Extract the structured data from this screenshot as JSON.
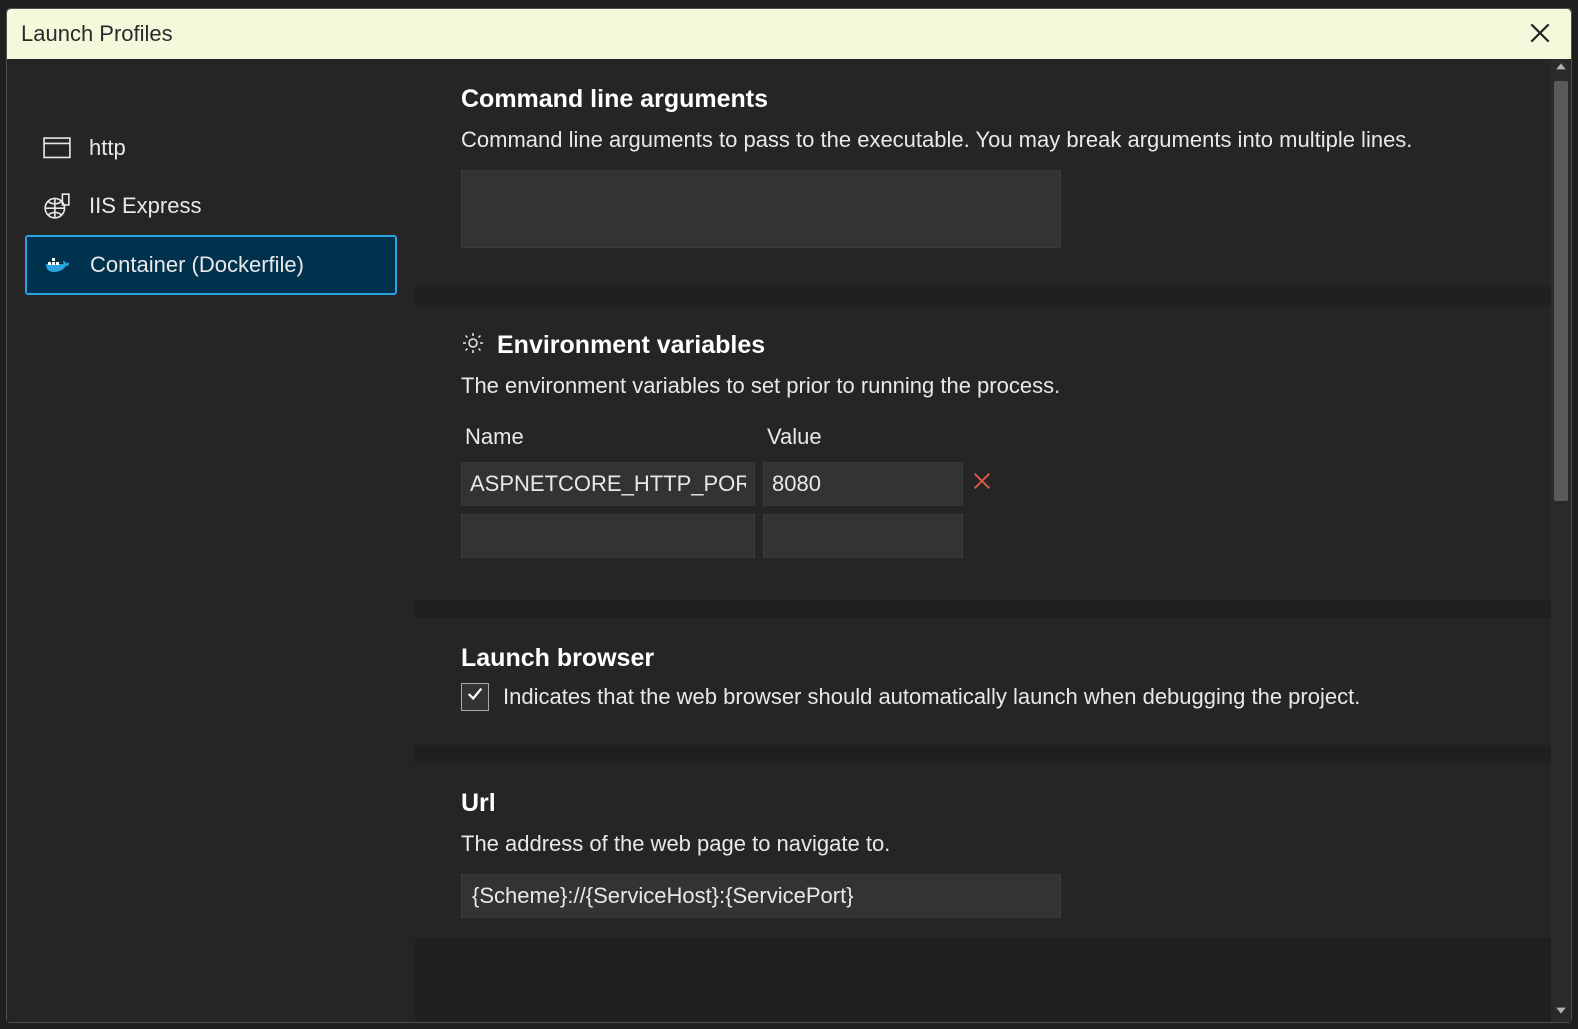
{
  "dialog": {
    "title": "Launch Profiles"
  },
  "profiles": {
    "items": [
      {
        "label": "http"
      },
      {
        "label": "IIS Express"
      },
      {
        "label": "Container (Dockerfile)"
      }
    ],
    "selected_index": 2
  },
  "sections": {
    "cmdline": {
      "title": "Command line arguments",
      "desc": "Command line arguments to pass to the executable. You may break arguments into multiple lines.",
      "value": ""
    },
    "env": {
      "title": "Environment variables",
      "desc": "The environment variables to set prior to running the process.",
      "headers": {
        "name": "Name",
        "value": "Value"
      },
      "rows": [
        {
          "name": "ASPNETCORE_HTTP_PORTS",
          "value": "8080"
        },
        {
          "name": "",
          "value": ""
        }
      ]
    },
    "browser": {
      "title": "Launch browser",
      "label": "Indicates that the web browser should automatically launch when debugging the project.",
      "checked": true
    },
    "url": {
      "title": "Url",
      "desc": "The address of the web page to navigate to.",
      "value": "{Scheme}://{ServiceHost}:{ServicePort}"
    }
  }
}
